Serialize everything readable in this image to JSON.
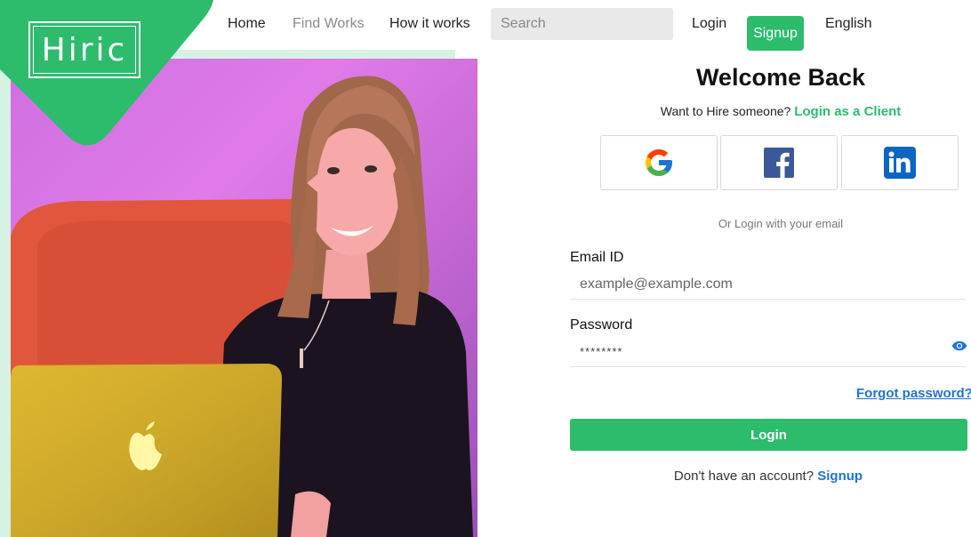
{
  "brand": {
    "logo_text": "Hiric",
    "accent": "#2cbc6c",
    "link_color": "#1f73d6"
  },
  "nav": {
    "home": "Home",
    "find_works": "Find Works",
    "how_it_works": "How it works",
    "search_placeholder": "Search",
    "login": "Login",
    "signup": "Signup",
    "language": "English"
  },
  "login_form": {
    "title": "Welcome Back",
    "hire_prompt": "Want to Hire someone?",
    "client_link": "Login as a Client",
    "social_buttons": [
      {
        "provider": "Google",
        "icon": "google-icon"
      },
      {
        "provider": "Facebook",
        "icon": "facebook-icon"
      },
      {
        "provider": "LinkedIn",
        "icon": "linkedin-icon"
      }
    ],
    "or_text": "Or Login with your email",
    "email_label": "Email ID",
    "email_placeholder": "example@example.com",
    "password_label": "Password",
    "password_value": "********",
    "forgot_password": "Forgot password?",
    "login_button": "Login",
    "no_account_text": "Don't have an account?",
    "signup_link": "Signup"
  }
}
